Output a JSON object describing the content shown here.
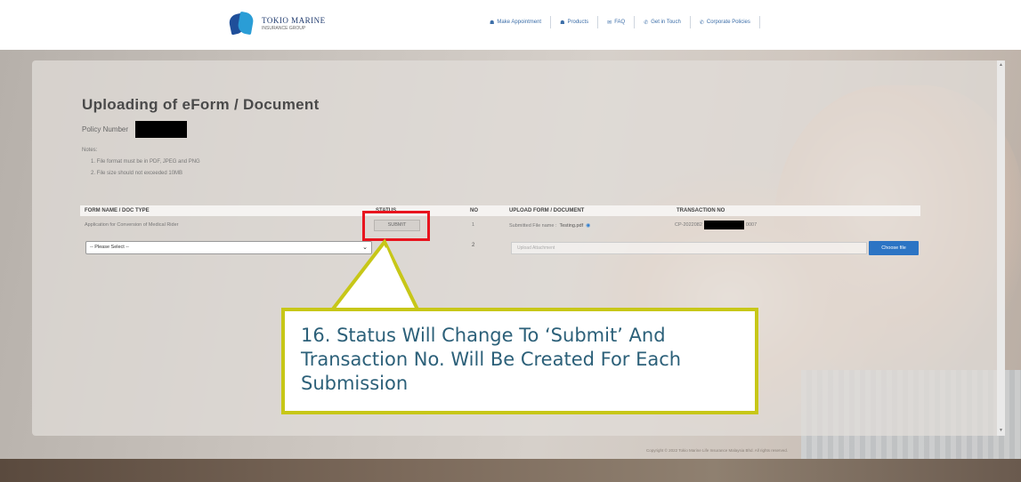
{
  "header": {
    "logo_line1": "TOKIO MARINE",
    "logo_line2": "INSURANCE GROUP",
    "nav": [
      {
        "icon": "user-icon",
        "glyph": "☗",
        "label": "Make Appointment"
      },
      {
        "icon": "box-icon",
        "glyph": "☗",
        "label": "Products"
      },
      {
        "icon": "chat-icon",
        "glyph": "✉",
        "label": "FAQ"
      },
      {
        "icon": "phone-icon",
        "glyph": "✆",
        "label": "Get in Touch"
      },
      {
        "icon": "phone-icon",
        "glyph": "✆",
        "label": "Corporate Policies"
      }
    ]
  },
  "page": {
    "title": "Uploading of eForm / Document",
    "policy_label": "Policy Number",
    "notes_title": "Notes:",
    "notes": [
      "1. File format must be in PDF, JPEG and PNG",
      "2. File size should not exceeded 10MB"
    ]
  },
  "table": {
    "headers": {
      "form": "FORM NAME / DOC TYPE",
      "status": "STATUS",
      "no": "NO",
      "upload": "UPLOAD FORM / DOCUMENT",
      "transaction": "TRANSACTION NO"
    },
    "row1": {
      "form": "Application for Conversion of Medical Rider",
      "status": "SUBMIT",
      "no": "1",
      "upload_prefix": "Submitted File name : ",
      "upload_file": "Testing.pdf",
      "trans_prefix": "CP-2022082",
      "trans_suffix": "0007"
    },
    "row2": {
      "select_value": "-- Please Select --",
      "no": "2",
      "upload_placeholder": "Upload Attachment",
      "choose_label": "Choose file"
    }
  },
  "footer_note": "Copyright © 2022 Tokio Marine Life Insurance Malaysia Bhd. All rights reserved.",
  "annotation": {
    "text": "16. Status Will Change To ‘Submit’ And Transaction No. Will Be Created For Each Submission",
    "highlight_color": "#e8141e",
    "callout_border": "#c7c718",
    "text_color": "#2c6079"
  },
  "colors": {
    "accent_blue": "#2c74c4",
    "nav_blue": "#3c6ea8"
  }
}
